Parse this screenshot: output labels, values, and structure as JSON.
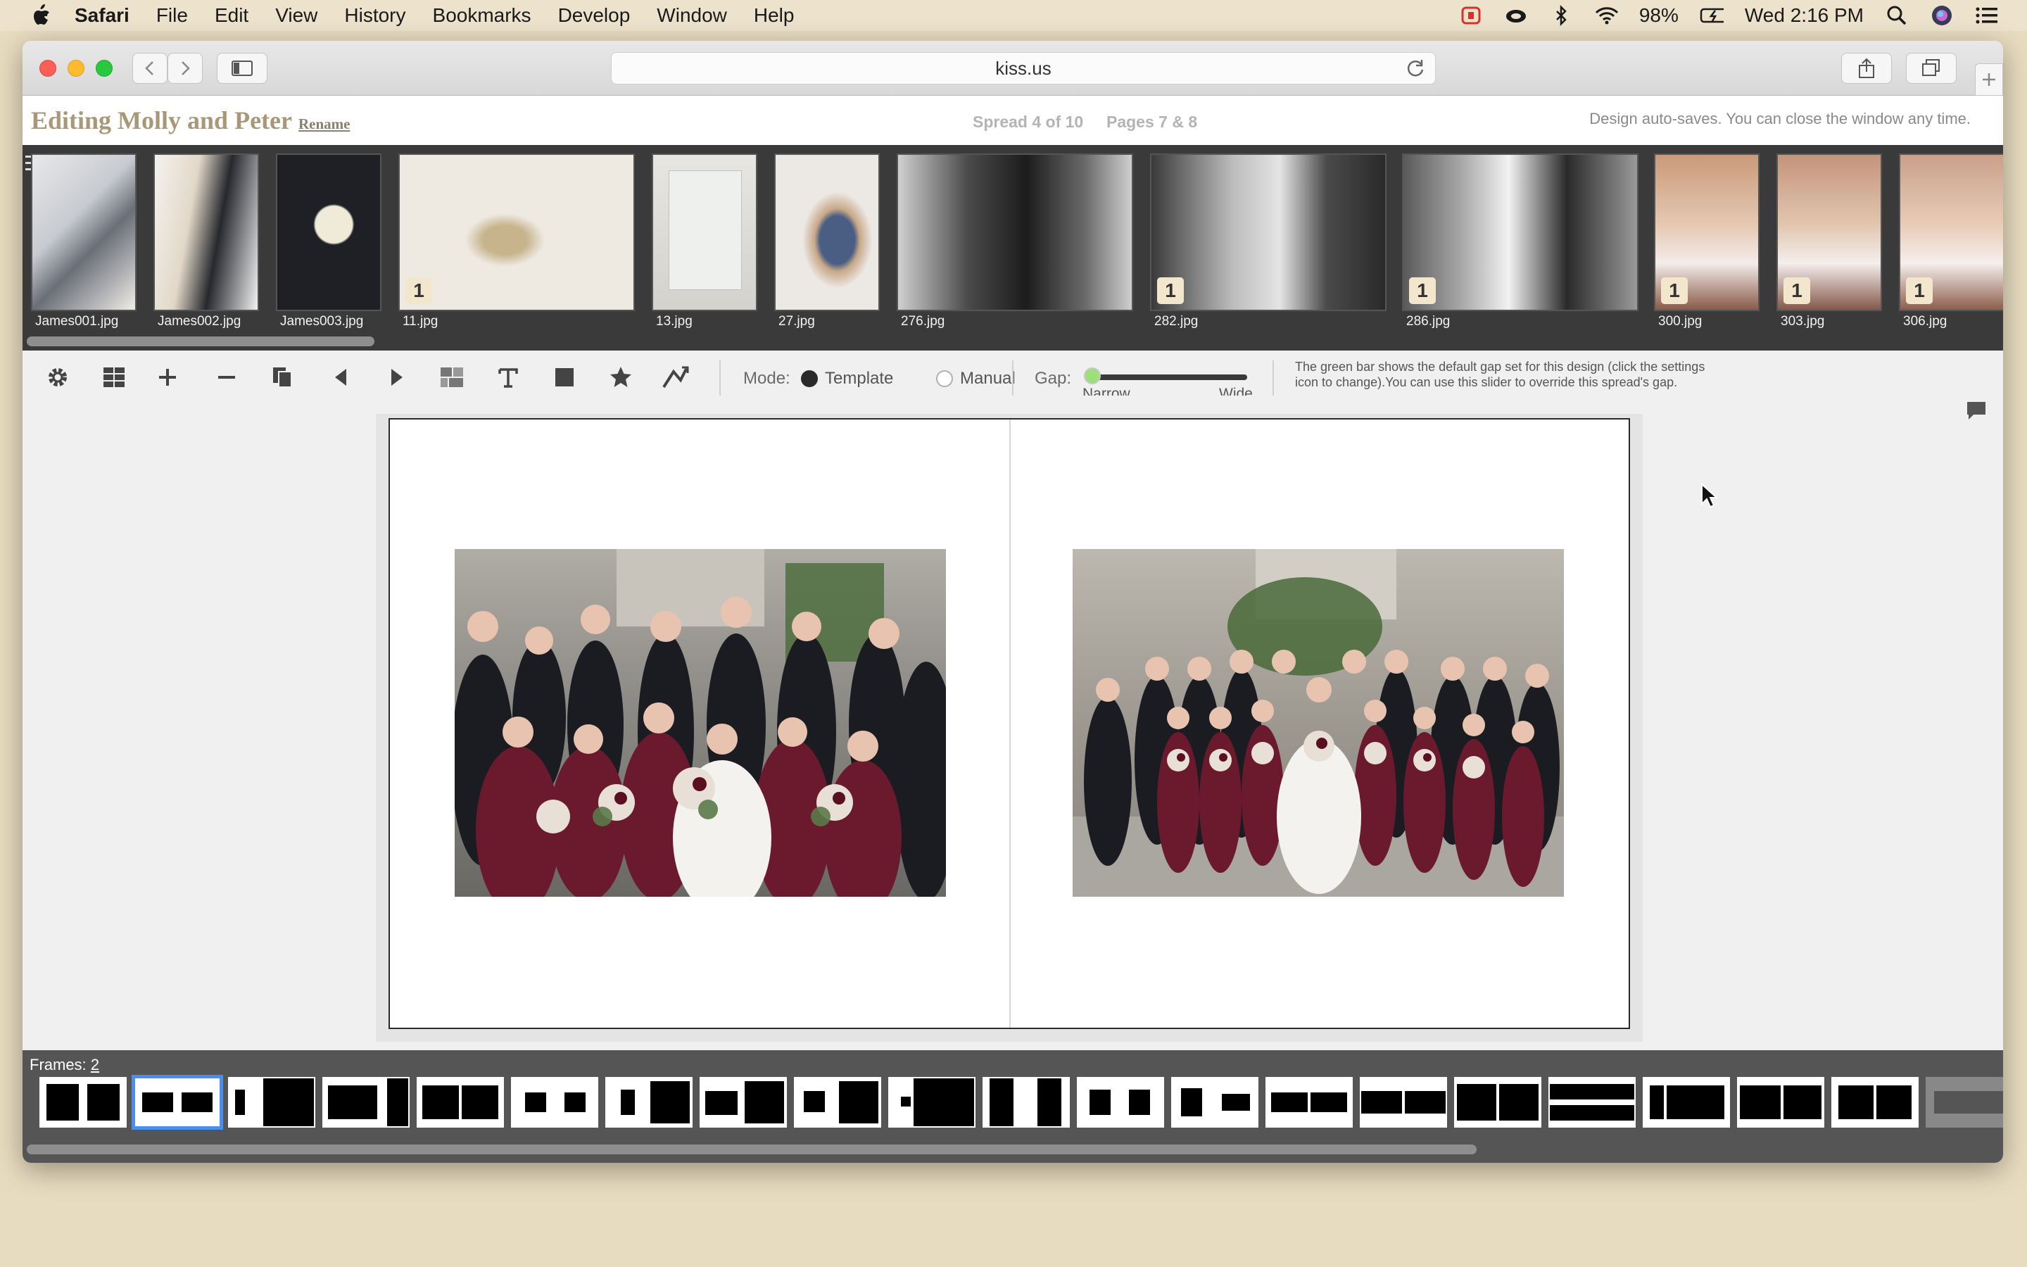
{
  "menubar": {
    "app": "Safari",
    "items": [
      "File",
      "Edit",
      "View",
      "History",
      "Bookmarks",
      "Develop",
      "Window",
      "Help"
    ],
    "battery": "98%",
    "clock": "Wed 2:16 PM"
  },
  "browser": {
    "url": "kiss.us"
  },
  "header": {
    "title": "Editing Molly and Peter",
    "rename_label": "Rename",
    "spread": "Spread 4 of 10",
    "pages": "Pages 7 & 8",
    "autosave": "Design auto-saves. You can close the window any time."
  },
  "strip": {
    "thumbs": [
      {
        "label": "James001.jpg",
        "badge": ""
      },
      {
        "label": "James002.jpg",
        "badge": ""
      },
      {
        "label": "James003.jpg",
        "badge": ""
      },
      {
        "label": "11.jpg",
        "badge": "1"
      },
      {
        "label": "13.jpg",
        "badge": ""
      },
      {
        "label": "27.jpg",
        "badge": ""
      },
      {
        "label": "276.jpg",
        "badge": ""
      },
      {
        "label": "282.jpg",
        "badge": "1"
      },
      {
        "label": "286.jpg",
        "badge": "1"
      },
      {
        "label": "300.jpg",
        "badge": "1"
      },
      {
        "label": "303.jpg",
        "badge": "1"
      },
      {
        "label": "306.jpg",
        "badge": "1"
      }
    ]
  },
  "toolbar": {
    "mode_label": "Mode:",
    "template_label": "Template",
    "manual_label": "Manual",
    "gap_label": "Gap:",
    "narrow_label": "Narrow",
    "wide_label": "Wide",
    "gap_help": "The green bar shows the default gap set for this design (click the settings icon to change).You can use this slider to override this spread's gap.",
    "mode_selected": "Template",
    "gap_value": 0
  },
  "frames": {
    "label": "Frames:",
    "count": "2",
    "selected_index": 1
  },
  "colors": {
    "accent": "#4a8ff0",
    "title": "#a89878",
    "gap_default": "#9de079",
    "wine": "#6b1a2e"
  }
}
